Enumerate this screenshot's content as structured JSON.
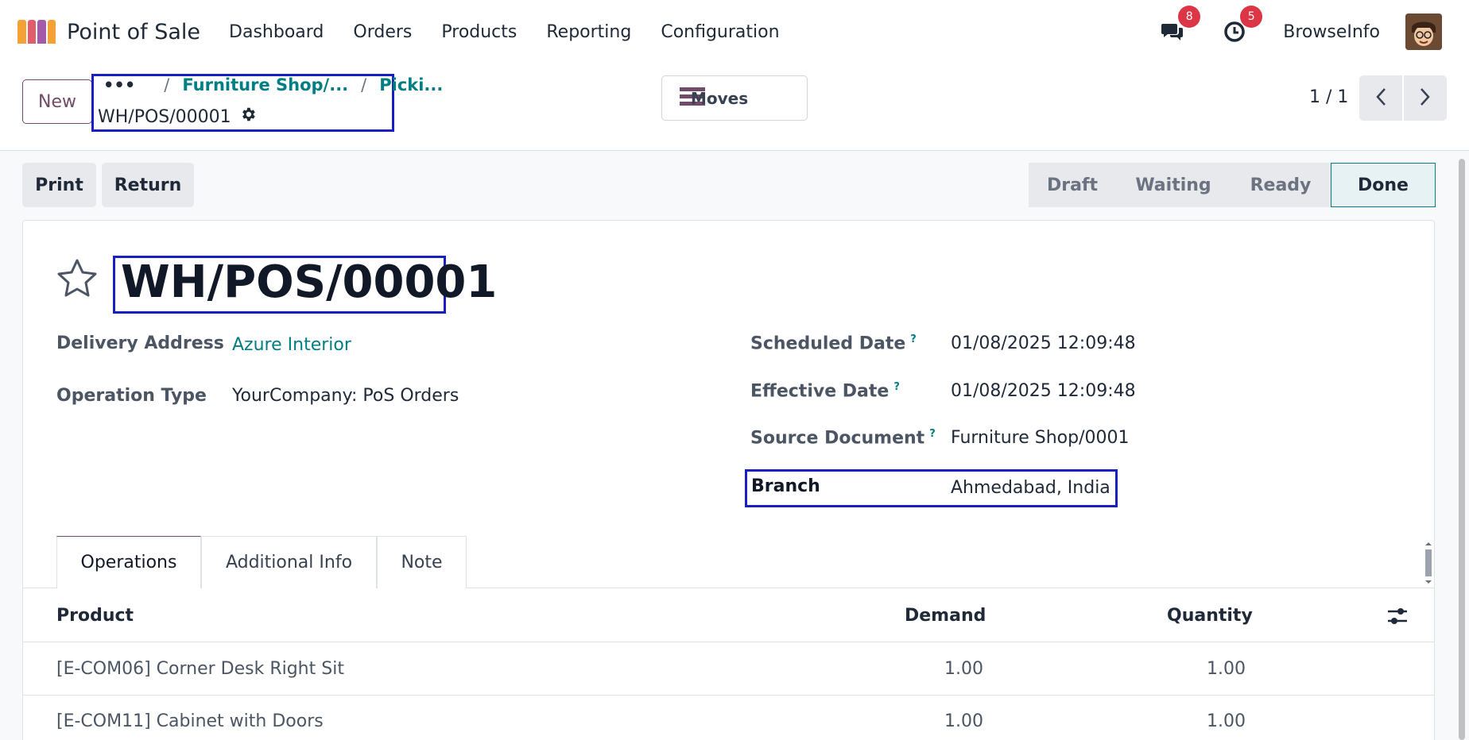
{
  "navbar": {
    "app_name": "Point of Sale",
    "menu": [
      "Dashboard",
      "Orders",
      "Products",
      "Reporting",
      "Configuration"
    ],
    "chat_count": "8",
    "activity_count": "5",
    "company": "BrowseInfo"
  },
  "control_panel": {
    "new_label": "New",
    "breadcrumb": {
      "dots": "•••",
      "items": [
        "Furniture Shop/...",
        "Picki..."
      ],
      "current": "WH/POS/00001"
    },
    "moves_label": "Moves",
    "pager": "1 / 1"
  },
  "actions": {
    "print": "Print",
    "return": "Return"
  },
  "status": {
    "stages": [
      "Draft",
      "Waiting",
      "Ready",
      "Done"
    ],
    "active": "Done"
  },
  "record": {
    "title": "WH/POS/00001",
    "left_fields": [
      {
        "label": "Delivery Address",
        "value": "Azure Interior"
      },
      {
        "label": "Operation Type",
        "value": "YourCompany: PoS Orders"
      }
    ],
    "right_fields": [
      {
        "label": "Scheduled Date",
        "help": "?",
        "value": "01/08/2025 12:09:48"
      },
      {
        "label": "Effective Date",
        "help": "?",
        "value": "01/08/2025 12:09:48"
      },
      {
        "label": "Source Document",
        "help": "?",
        "value": "Furniture Shop/0001"
      },
      {
        "label": "Branch",
        "value": "Ahmedabad, India"
      }
    ]
  },
  "tabs": [
    "Operations",
    "Additional Info",
    "Note"
  ],
  "table": {
    "columns": [
      "Product",
      "Demand",
      "Quantity"
    ],
    "rows": [
      {
        "product": "[E-COM06] Corner Desk Right Sit",
        "demand": "1.00",
        "quantity": "1.00"
      },
      {
        "product": "[E-COM11] Cabinet with Doors",
        "demand": "1.00",
        "quantity": "1.00"
      }
    ]
  },
  "colors": {
    "brand": "#714b67",
    "accent": "#017e84",
    "highlight": "#1a1fc4",
    "badge": "#dc3545"
  }
}
